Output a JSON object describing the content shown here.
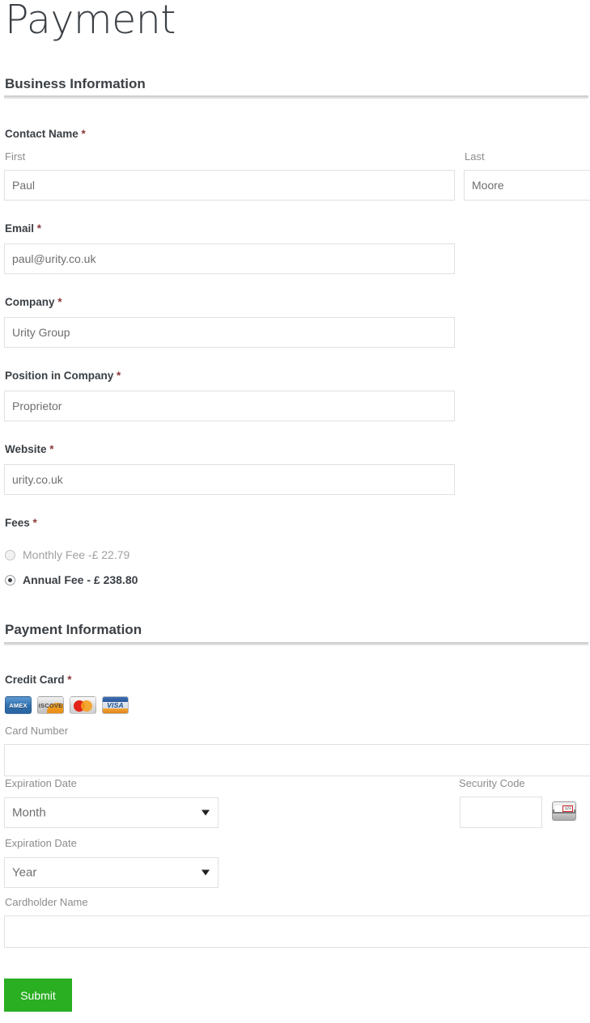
{
  "form": {
    "title": "Payment",
    "sections": [
      {
        "heading": "Business Information"
      },
      {
        "heading": "Payment Information"
      }
    ]
  },
  "business": {
    "contact_name": {
      "label": "Contact Name",
      "required_mark": "*",
      "first": {
        "sub_label": "First",
        "value": "Paul"
      },
      "last": {
        "sub_label": "Last",
        "value": "Moore"
      }
    },
    "email": {
      "label": "Email",
      "required_mark": "*",
      "value": "paul@urity.co.uk"
    },
    "company": {
      "label": "Company",
      "required_mark": "*",
      "value": "Urity Group"
    },
    "position": {
      "label": "Position in Company",
      "required_mark": "*",
      "value": "Proprietor"
    },
    "website": {
      "label": "Website",
      "required_mark": "*",
      "value": "urity.co.uk"
    },
    "fees": {
      "label": "Fees",
      "required_mark": "*",
      "options": [
        {
          "label": "Monthly Fee -£ 22.79",
          "selected": false
        },
        {
          "label": "Annual Fee - £ 238.80",
          "selected": true
        }
      ]
    }
  },
  "payment": {
    "credit_card": {
      "label": "Credit Card",
      "required_mark": "*",
      "accepted_cards": [
        {
          "name": "amex-card-icon",
          "caption": "AMEX"
        },
        {
          "name": "discover-card-icon",
          "caption": "DISCOVER"
        },
        {
          "name": "mastercard-card-icon",
          "caption": ""
        },
        {
          "name": "visa-card-icon",
          "caption": "VISA"
        }
      ]
    },
    "card_number": {
      "sub_label": "Card Number",
      "value": ""
    },
    "exp_month": {
      "sub_label": "Expiration Date",
      "selected": "Month"
    },
    "exp_year": {
      "sub_label": "Expiration Date",
      "selected": "Year"
    },
    "security_code": {
      "sub_label": "Security Code",
      "value": "",
      "hint_digits": "123"
    },
    "cardholder_name": {
      "sub_label": "Cardholder Name",
      "value": ""
    }
  },
  "actions": {
    "submit_label": "Submit",
    "submit_color": "#2aae22"
  }
}
